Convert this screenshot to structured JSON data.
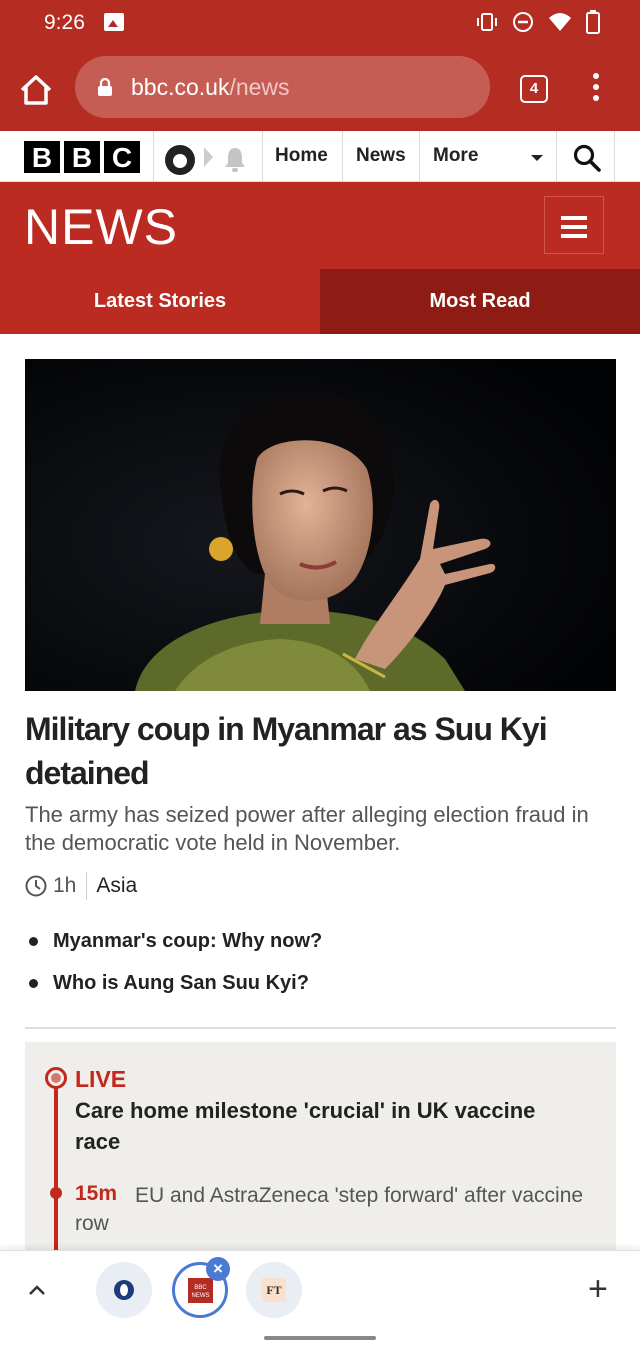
{
  "status_bar": {
    "time": "9:26",
    "icons": [
      "image-icon",
      "vibrate-icon",
      "do-not-disturb-icon",
      "wifi-icon",
      "battery-icon"
    ]
  },
  "browser": {
    "url_host": "bbc.co.uk",
    "url_path": "/news",
    "tab_count": "4"
  },
  "bbc_nav": {
    "logo_letters": [
      "B",
      "B",
      "C"
    ],
    "links": [
      "Home",
      "News",
      "More"
    ]
  },
  "news_header": {
    "title": "NEWS"
  },
  "tabs": [
    {
      "label": "Latest Stories",
      "selected": true
    },
    {
      "label": "Most Read",
      "selected": false
    }
  ],
  "top_story": {
    "headline": "Military coup in Myanmar as Suu Kyi detained",
    "summary": "The army has seized power after alleging election fraud in the democratic vote held in November.",
    "age": "1h",
    "section": "Asia",
    "related": [
      "Myanmar's coup: Why now?",
      "Who is Aung San Suu Kyi?"
    ]
  },
  "live": {
    "label": "LIVE",
    "title": "Care home milestone 'crucial' in UK vaccine race",
    "update_time": "15m",
    "update_text": "EU and AstraZeneca 'step forward' after vaccine row"
  },
  "tab_strip": {
    "close_glyph": "×",
    "new_tab_glyph": "+",
    "tab2_badge": "BBC NEWS",
    "tab3_badge": "FT"
  },
  "colors": {
    "brand_red": "#bb2b21",
    "dark_red": "#8e1b14",
    "live_red": "#c2281c",
    "accent_blue": "#4a7ad1"
  }
}
